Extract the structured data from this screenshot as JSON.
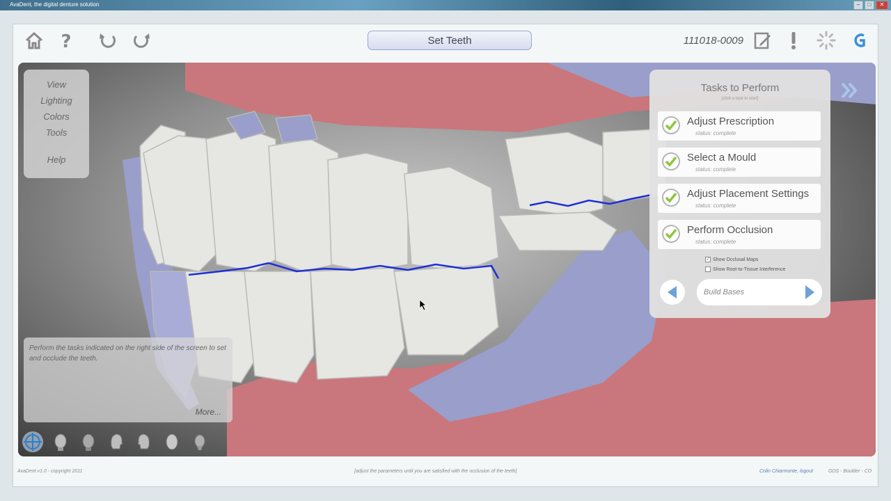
{
  "window": {
    "title": "AvaDent, the digital denture solution"
  },
  "toolbar": {
    "step_title": "Set Teeth",
    "case_id": "111018-0009"
  },
  "left_menu": {
    "items": [
      "View",
      "Lighting",
      "Colors",
      "Tools",
      "Help"
    ]
  },
  "info_box": {
    "message": "Perform the tasks indicated on the right side of the screen to set and occlude the teeth.",
    "more_label": "More..."
  },
  "task_panel": {
    "title": "Tasks to Perform",
    "subtitle": "[click a task to start]",
    "tasks": [
      {
        "label": "Adjust Prescription",
        "status": "status: complete"
      },
      {
        "label": "Select a Mould",
        "status": "status: complete"
      },
      {
        "label": "Adjust Placement Settings",
        "status": "status: complete"
      },
      {
        "label": "Perform Occlusion",
        "status": "status: complete"
      }
    ],
    "options": [
      {
        "label": "Show Occlusal Maps",
        "checked": true
      },
      {
        "label": "Show Root-to-Tissue Interference",
        "checked": false
      }
    ],
    "next_step_label": "Build Bases"
  },
  "footer": {
    "left": "AvaDent v1.0 - copyright 2011",
    "center": "[adjust the parameters until you are satisfied with the occlusion of the teeth]",
    "user": "Colin Chiarmonte, logout",
    "location": "GDS - Boulder - CO"
  },
  "colors": {
    "gum": "#c9777c",
    "wax": "#9a9ecb",
    "tooth": "#e6e6e3",
    "occlusal": "#1d2fd6",
    "check": "#8cc63f"
  }
}
